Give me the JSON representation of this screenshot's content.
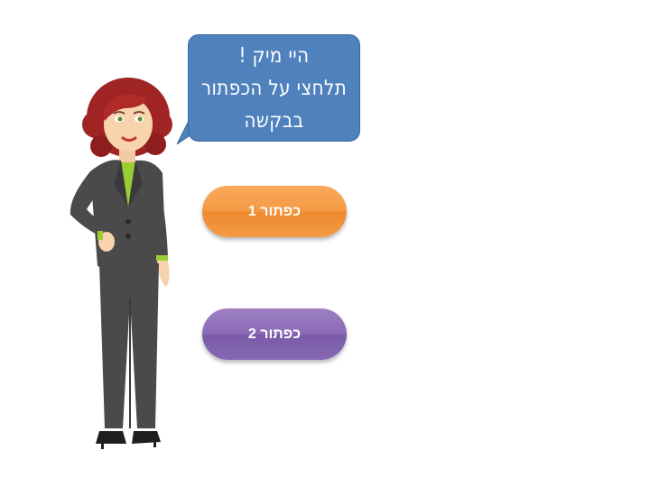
{
  "speech_bubble": {
    "lines": [
      "היי מיק !",
      "תלחצי על הכפתור",
      "בבקשה"
    ],
    "color": "#4f81bd"
  },
  "buttons": [
    {
      "label": "כפתור 1",
      "color": "#f59a45"
    },
    {
      "label": "כפתור 2",
      "color": "#8c6cb6"
    }
  ]
}
